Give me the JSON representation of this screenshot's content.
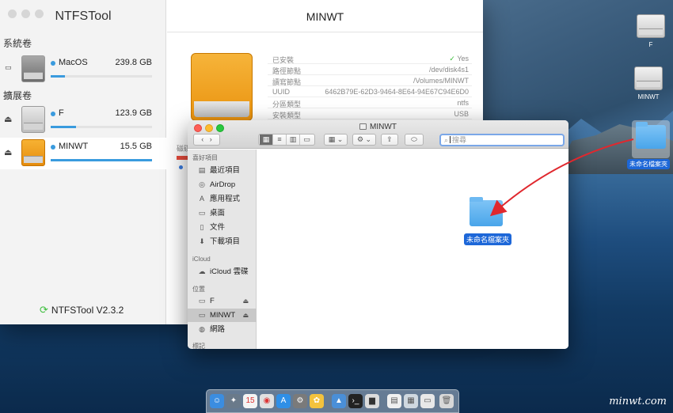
{
  "ntfstool": {
    "app_title": "NTFSTool",
    "section_system": "系統卷",
    "section_external": "擴展卷",
    "volumes": [
      {
        "name": "MacOS",
        "size": "239.8 GB",
        "fill": 0.14
      },
      {
        "name": "F",
        "size": "123.9 GB",
        "fill": 0.25
      },
      {
        "name": "MINWT",
        "size": "15.5 GB",
        "fill": 1.0
      }
    ],
    "version": "NTFSTool V2.3.2",
    "detail": {
      "title": "MINWT",
      "rows": [
        {
          "key": "已安裝",
          "value": "Yes"
        },
        {
          "key": "路徑節點",
          "value": "/dev/disk4s1"
        },
        {
          "key": "讀寫節點",
          "value": "/Volumes/MINWT"
        },
        {
          "key": "UUID",
          "value": "6462B79E-62D3-9464-8E64-94E67C94E6D0"
        },
        {
          "key": "分區類型",
          "value": "ntfs"
        },
        {
          "key": "安裝類型",
          "value": "USB"
        }
      ],
      "side_label": "磁碟"
    }
  },
  "finder": {
    "title": "MINWT",
    "search_placeholder": "搜尋",
    "favorites_header": "喜好項目",
    "favorites": [
      "最近項目",
      "AirDrop",
      "應用程式",
      "桌面",
      "文件",
      "下載項目"
    ],
    "icloud_header": "iCloud",
    "icloud_items": [
      "iCloud 雲碟"
    ],
    "locations_header": "位置",
    "locations": [
      "F",
      "MINWT",
      "網路"
    ],
    "tags_header": "標記",
    "folder_label": "未命名檔案夾"
  },
  "desktop": {
    "icons": [
      "F",
      "MINWT"
    ],
    "folder_label": "未命名檔案夾"
  },
  "watermark": "minwt.com",
  "colors": {
    "accent": "#3a9bde",
    "selection": "#1d67d8",
    "arrow": "#e0282e"
  }
}
